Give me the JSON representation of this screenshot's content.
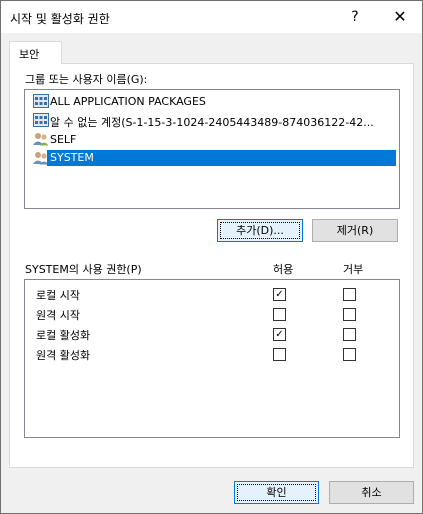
{
  "window": {
    "title": "시작 및 활성화 권한",
    "help_label": "?",
    "close_label": "✕"
  },
  "tab": {
    "label": "보안"
  },
  "group_list": {
    "label": "그룹 또는 사용자 이름(G):",
    "items": [
      {
        "label": "ALL APPLICATION PACKAGES",
        "icon": "app-packages-icon",
        "selected": false
      },
      {
        "label": "알 수 없는 계정(S-1-15-3-1024-2405443489-874036122-42...",
        "icon": "unknown-account-icon",
        "selected": false
      },
      {
        "label": "SELF",
        "icon": "users-icon",
        "selected": false
      },
      {
        "label": "SYSTEM",
        "icon": "users-icon",
        "selected": true
      }
    ]
  },
  "buttons": {
    "add": "추가(D)...",
    "remove": "제거(R)",
    "ok": "확인",
    "cancel": "취소"
  },
  "permissions": {
    "label": "SYSTEM의 사용 권한(P)",
    "allow_header": "허용",
    "deny_header": "거부",
    "rows": [
      {
        "label": "로컬 시작",
        "allow": true,
        "deny": false
      },
      {
        "label": "원격 시작",
        "allow": false,
        "deny": false
      },
      {
        "label": "로컬 활성화",
        "allow": true,
        "deny": false
      },
      {
        "label": "원격 활성화",
        "allow": false,
        "deny": false
      }
    ]
  }
}
